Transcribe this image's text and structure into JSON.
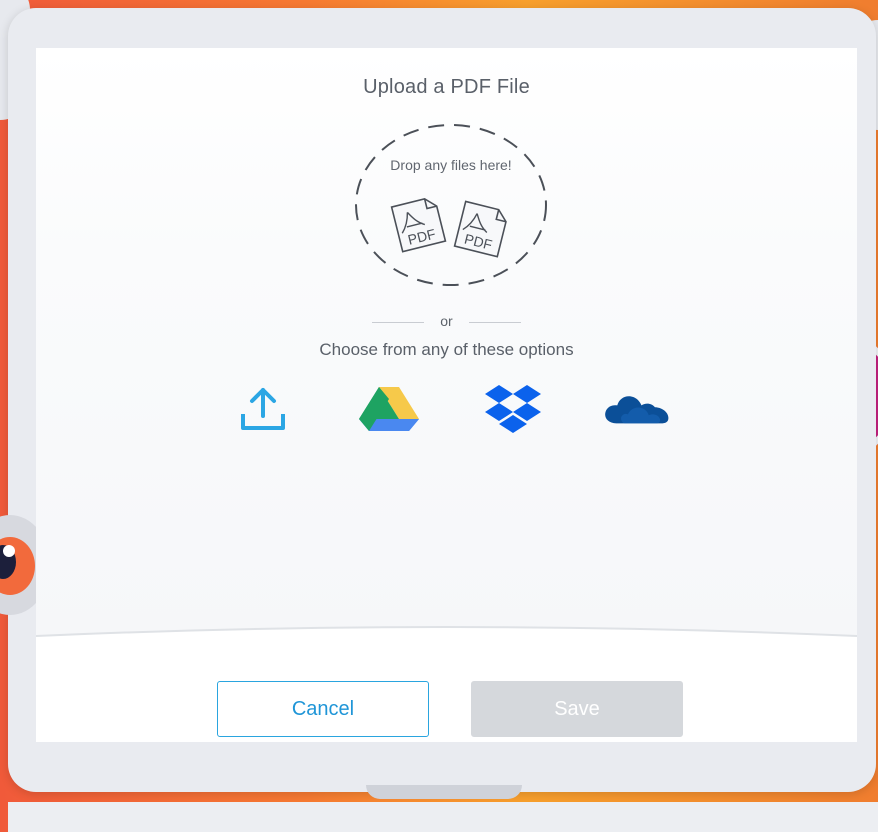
{
  "dialog": {
    "title": "Upload a PDF File",
    "dropzone": {
      "text": "Drop any files here!",
      "file_icon_label": "PDF"
    },
    "separator": "or",
    "options_text": "Choose from any of these options",
    "options": [
      {
        "name": "upload-from-computer",
        "icon": "upload-icon"
      },
      {
        "name": "google-drive",
        "icon": "google-drive-icon"
      },
      {
        "name": "dropbox",
        "icon": "dropbox-icon"
      },
      {
        "name": "onedrive",
        "icon": "onedrive-icon"
      }
    ],
    "buttons": {
      "cancel": "Cancel",
      "save": "Save"
    }
  },
  "colors": {
    "accent_blue": "#1f95d7",
    "upload_icon": "#2ba6e4",
    "dropbox_blue": "#0b62ec",
    "onedrive_blue": "#0b4f98",
    "save_disabled": "#d5d8dc",
    "drive_yellow": "#f6c94a",
    "drive_green": "#1ea362",
    "drive_blue": "#4a88f0"
  }
}
